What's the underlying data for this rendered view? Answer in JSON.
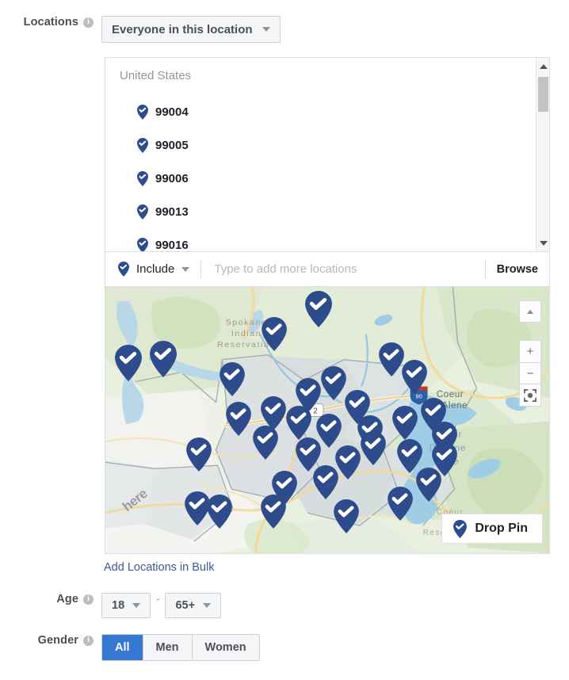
{
  "colors": {
    "accent_blue": "#3578d4",
    "link_blue": "#3b5998",
    "pin_navy": "#2e4b8c",
    "label_gray": "#4b4f56",
    "border_gray": "#ccd0d5"
  },
  "locations": {
    "label": "Locations",
    "info_icon": "info-icon",
    "audience_selector": {
      "value": "Everyone in this location",
      "caret_icon": "chevron-down-icon"
    },
    "list": {
      "country_header": "United States",
      "items": [
        {
          "name": "99004",
          "icon": "map-pin-check-icon"
        },
        {
          "name": "99005",
          "icon": "map-pin-check-icon"
        },
        {
          "name": "99006",
          "icon": "map-pin-check-icon"
        },
        {
          "name": "99013",
          "icon": "map-pin-check-icon"
        },
        {
          "name": "99016",
          "icon": "map-pin-check-icon"
        }
      ],
      "scrollbar": {
        "up_icon": "scroll-up-arrow-icon",
        "down_icon": "scroll-down-arrow-icon"
      }
    },
    "add_row": {
      "mode_label": "Include",
      "mode_icon": "map-pin-check-icon",
      "mode_caret_icon": "chevron-down-icon",
      "input_value": "",
      "input_placeholder": "Type to add more locations",
      "browse_label": "Browse"
    },
    "bulk_link": "Add Locations in Bulk"
  },
  "map": {
    "labels": {
      "spokane_reservation": "Spokane\nIndian\nReservation",
      "coeur_dalene_city": "Coeur\nD'Alene",
      "coeur_dalene_lake": "Coeur\nD'Alene\nLake",
      "coeur_reservation": "Coeur\nd'\nReservation",
      "watermark": "here",
      "highway_shield": "2",
      "interstate_shield": "90"
    },
    "controls": {
      "collapse_icon": "chevron-up-icon",
      "zoom_in": "+",
      "zoom_out": "−",
      "fit_icon": "fit-bounds-icon"
    },
    "drop_pin": {
      "label": "Drop Pin",
      "icon": "map-pin-check-icon"
    },
    "pin_icon": "map-pin-check-icon",
    "pin_count": 29
  },
  "age": {
    "label": "Age",
    "info_icon": "info-icon",
    "min": "18",
    "max": "65+",
    "separator": "-",
    "caret_icon": "chevron-down-icon"
  },
  "gender": {
    "label": "Gender",
    "info_icon": "info-icon",
    "options": [
      {
        "label": "All",
        "selected": true
      },
      {
        "label": "Men",
        "selected": false
      },
      {
        "label": "Women",
        "selected": false
      }
    ]
  }
}
